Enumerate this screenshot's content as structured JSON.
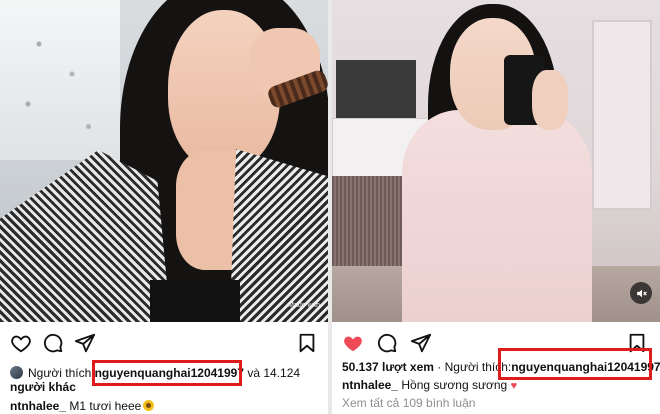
{
  "left_post": {
    "photo_watermark": "Made with",
    "likes_prefix": "Người thích:",
    "liker_username": "nguyenquanghai12041997",
    "likes_suffix": "và 14.124",
    "likes_suffix_line2": "người khác",
    "caption_user": "ntnhalee_",
    "caption_text": "M1 tươi heee"
  },
  "right_post": {
    "views": "50.137 lượt xem",
    "likes_prefix": "· Người thích:",
    "liker_username": "nguyenquanghai12041997",
    "caption_user": "ntnhalee_",
    "caption_text": "Hồng sương sương",
    "view_comments": "Xem tất cả 109 bình luận"
  },
  "icons": {
    "left_actions": [
      "heart-outline-icon",
      "comment-icon",
      "share-icon",
      "bookmark-icon"
    ],
    "right_actions": [
      "heart-filled-icon",
      "comment-icon",
      "share-icon",
      "bookmark-icon"
    ],
    "photo_overlays": [
      "mute-icon"
    ]
  },
  "colors": {
    "highlight_box": "#e01b1b",
    "like_red": "#ed4956",
    "muted_text": "#8e8e8e"
  }
}
